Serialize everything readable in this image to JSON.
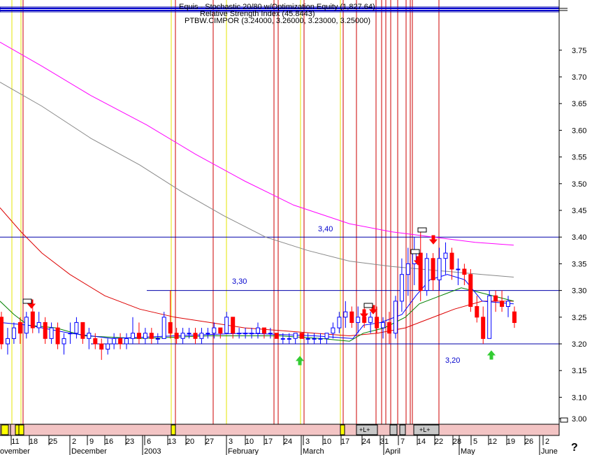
{
  "header": {
    "line1": "Equis - Stochastic 20/80 w/Optimization Equity (1,827.64)",
    "line2": "Relative Strength Index (45.8443)",
    "line3": "PTBW.CIMPOR (3.24000, 3.26000, 3.23000, 3.25000)"
  },
  "colors": {
    "bull": "#0000ff",
    "bear": "#ff0000",
    "ma_magenta": "#ff00ff",
    "ma_gray": "#888888",
    "ma_red": "#dd0000",
    "ma_green": "#008000",
    "vline_red": "#cc0000",
    "vline_yellow": "#e6e600",
    "level": "#0000aa",
    "arrow_sell": "#ff0000",
    "arrow_buy": "#33cc33"
  },
  "level_labels": [
    "3,40",
    "3,30",
    "3,20"
  ],
  "corner_mark": "?",
  "chart_data": {
    "type": "candlestick",
    "ylim": [
      3.1,
      3.79
    ],
    "y_ticks": [
      "3.75",
      "3.70",
      "3.65",
      "3.60",
      "3.55",
      "3.50",
      "3.45",
      "3.40",
      "3.35",
      "3.30",
      "3.25",
      "3.20",
      "3.15",
      "3.10",
      "3.00"
    ],
    "x_ticks": [
      "11",
      "18",
      "25",
      "2",
      "9",
      "16",
      "23",
      "6",
      "13",
      "20",
      "27",
      "3",
      "10",
      "17",
      "24",
      "3",
      "10",
      "17",
      "24",
      "31",
      "7",
      "14",
      "22",
      "28",
      "5",
      "12",
      "19",
      "26",
      "2"
    ],
    "x_months": [
      "ovember",
      "December",
      "2003",
      "February",
      "March",
      "April",
      "May",
      "June"
    ],
    "levels": [
      {
        "label": "3,40",
        "value": 3.4
      },
      {
        "label": "3,30",
        "value": 3.3
      },
      {
        "label": "3,20",
        "value": 3.2
      }
    ],
    "candles": [
      [
        3.25,
        3.26,
        3.19,
        3.2
      ],
      [
        3.2,
        3.23,
        3.18,
        3.21
      ],
      [
        3.21,
        3.24,
        3.2,
        3.23
      ],
      [
        3.24,
        3.25,
        3.2,
        3.22
      ],
      [
        3.22,
        3.26,
        3.21,
        3.25
      ],
      [
        3.26,
        3.27,
        3.22,
        3.23
      ],
      [
        3.23,
        3.26,
        3.22,
        3.24
      ],
      [
        3.24,
        3.25,
        3.2,
        3.21
      ],
      [
        3.21,
        3.24,
        3.2,
        3.23
      ],
      [
        3.23,
        3.24,
        3.19,
        3.2
      ],
      [
        3.2,
        3.22,
        3.18,
        3.21
      ],
      [
        3.22,
        3.24,
        3.2,
        3.22
      ],
      [
        3.22,
        3.25,
        3.21,
        3.24
      ],
      [
        3.24,
        3.24,
        3.2,
        3.21
      ],
      [
        3.21,
        3.23,
        3.19,
        3.22
      ],
      [
        3.21,
        3.22,
        3.19,
        3.2
      ],
      [
        3.2,
        3.21,
        3.17,
        3.19
      ],
      [
        3.19,
        3.21,
        3.18,
        3.2
      ],
      [
        3.2,
        3.22,
        3.19,
        3.21
      ],
      [
        3.21,
        3.22,
        3.19,
        3.2
      ],
      [
        3.2,
        3.22,
        3.19,
        3.21
      ],
      [
        3.21,
        3.25,
        3.2,
        3.22
      ],
      [
        3.22,
        3.24,
        3.2,
        3.21
      ],
      [
        3.21,
        3.23,
        3.2,
        3.22
      ],
      [
        3.22,
        3.23,
        3.2,
        3.21
      ],
      [
        3.21,
        3.22,
        3.2,
        3.21
      ],
      [
        3.21,
        3.26,
        3.21,
        3.25
      ],
      [
        3.24,
        3.3,
        3.21,
        3.22
      ],
      [
        3.22,
        3.23,
        3.2,
        3.21
      ],
      [
        3.21,
        3.23,
        3.2,
        3.22
      ],
      [
        3.22,
        3.23,
        3.21,
        3.22
      ],
      [
        3.22,
        3.23,
        3.2,
        3.21
      ],
      [
        3.21,
        3.23,
        3.2,
        3.22
      ],
      [
        3.22,
        3.23,
        3.21,
        3.22
      ],
      [
        3.22,
        3.24,
        3.21,
        3.23
      ],
      [
        3.23,
        3.23,
        3.21,
        3.22
      ],
      [
        3.22,
        3.26,
        3.22,
        3.25
      ],
      [
        3.25,
        3.25,
        3.21,
        3.22
      ],
      [
        3.22,
        3.23,
        3.21,
        3.22
      ],
      [
        3.22,
        3.23,
        3.21,
        3.22
      ],
      [
        3.22,
        3.23,
        3.21,
        3.22
      ],
      [
        3.22,
        3.24,
        3.21,
        3.23
      ],
      [
        3.23,
        3.23,
        3.21,
        3.22
      ],
      [
        3.22,
        3.23,
        3.21,
        3.22
      ],
      [
        3.22,
        3.22,
        3.21,
        3.21
      ],
      [
        3.21,
        3.22,
        3.2,
        3.21
      ],
      [
        3.21,
        3.22,
        3.2,
        3.21
      ],
      [
        3.21,
        3.22,
        3.2,
        3.22
      ],
      [
        3.22,
        3.22,
        3.21,
        3.21
      ],
      [
        3.21,
        3.22,
        3.2,
        3.21
      ],
      [
        3.21,
        3.22,
        3.2,
        3.21
      ],
      [
        3.21,
        3.22,
        3.2,
        3.21
      ],
      [
        3.21,
        3.22,
        3.2,
        3.22
      ],
      [
        3.22,
        3.24,
        3.21,
        3.23
      ],
      [
        3.23,
        3.26,
        3.22,
        3.25
      ],
      [
        3.25,
        3.28,
        3.23,
        3.26
      ],
      [
        3.26,
        3.27,
        3.23,
        3.24
      ],
      [
        3.24,
        3.27,
        3.22,
        3.25
      ],
      [
        3.25,
        3.27,
        3.23,
        3.24
      ],
      [
        3.24,
        3.26,
        3.22,
        3.25
      ],
      [
        3.25,
        3.27,
        3.22,
        3.23
      ],
      [
        3.23,
        3.25,
        3.21,
        3.24
      ],
      [
        3.24,
        3.26,
        3.2,
        3.22
      ],
      [
        3.22,
        3.29,
        3.21,
        3.28
      ],
      [
        3.28,
        3.36,
        3.26,
        3.33
      ],
      [
        3.33,
        3.38,
        3.29,
        3.35
      ],
      [
        3.35,
        3.4,
        3.31,
        3.37
      ],
      [
        3.37,
        3.41,
        3.28,
        3.3
      ],
      [
        3.3,
        3.37,
        3.29,
        3.36
      ],
      [
        3.36,
        3.37,
        3.3,
        3.32
      ],
      [
        3.32,
        3.38,
        3.3,
        3.36
      ],
      [
        3.36,
        3.39,
        3.33,
        3.37
      ],
      [
        3.37,
        3.38,
        3.32,
        3.34
      ],
      [
        3.34,
        3.36,
        3.31,
        3.34
      ],
      [
        3.34,
        3.35,
        3.31,
        3.33
      ],
      [
        3.33,
        3.34,
        3.26,
        3.27
      ],
      [
        3.27,
        3.29,
        3.24,
        3.25
      ],
      [
        3.25,
        3.27,
        3.2,
        3.21
      ],
      [
        3.21,
        3.3,
        3.21,
        3.29
      ],
      [
        3.29,
        3.3,
        3.26,
        3.28
      ],
      [
        3.28,
        3.3,
        3.26,
        3.27
      ],
      [
        3.27,
        3.29,
        3.25,
        3.28
      ],
      [
        3.26,
        3.27,
        3.23,
        3.24
      ]
    ]
  }
}
